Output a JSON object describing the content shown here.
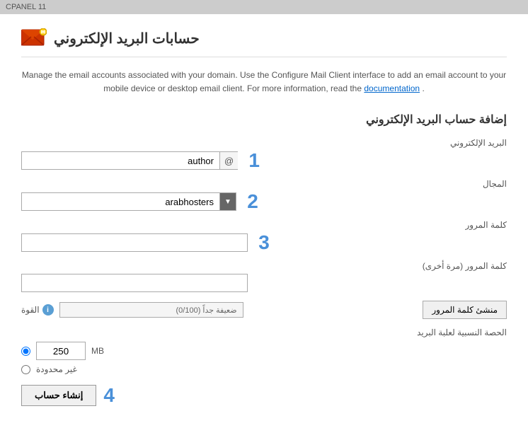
{
  "topbar": {
    "label": "CPANEL 11"
  },
  "header": {
    "title": "حسابات البريد الإلكتروني"
  },
  "description": {
    "text": "Manage the email accounts associated with your domain. Use the Configure Mail Client interface to add an email account to your mobile device or desktop email client. For more information, read the",
    "link_text": "documentation",
    "suffix": "."
  },
  "form": {
    "section_title": "إضافة حساب البريد الإلكتروني",
    "email_label": "البريد الإلكتروني",
    "email_value": "author",
    "at_sign": "@",
    "domain_label": "المجال",
    "domain_value": "arabhosters",
    "domain_arrow": "▼",
    "password_label": "كلمة المرور",
    "password_confirm_label": "كلمة المرور (مرة أخرى)",
    "strength_label": "القوة",
    "strength_info": "i",
    "strength_value": "ضعيفة جداً (0/100)",
    "generate_btn": "منشئ كلمة المرور",
    "quota_title": "الحصة النسبية لعلبة البريد",
    "quota_mb_label": "MB",
    "quota_value": "250",
    "unlimited_label": "غير محدودة",
    "step1": "1",
    "step2": "2",
    "step3": "3",
    "step4": "4",
    "create_btn": "إنشاء حساب"
  }
}
